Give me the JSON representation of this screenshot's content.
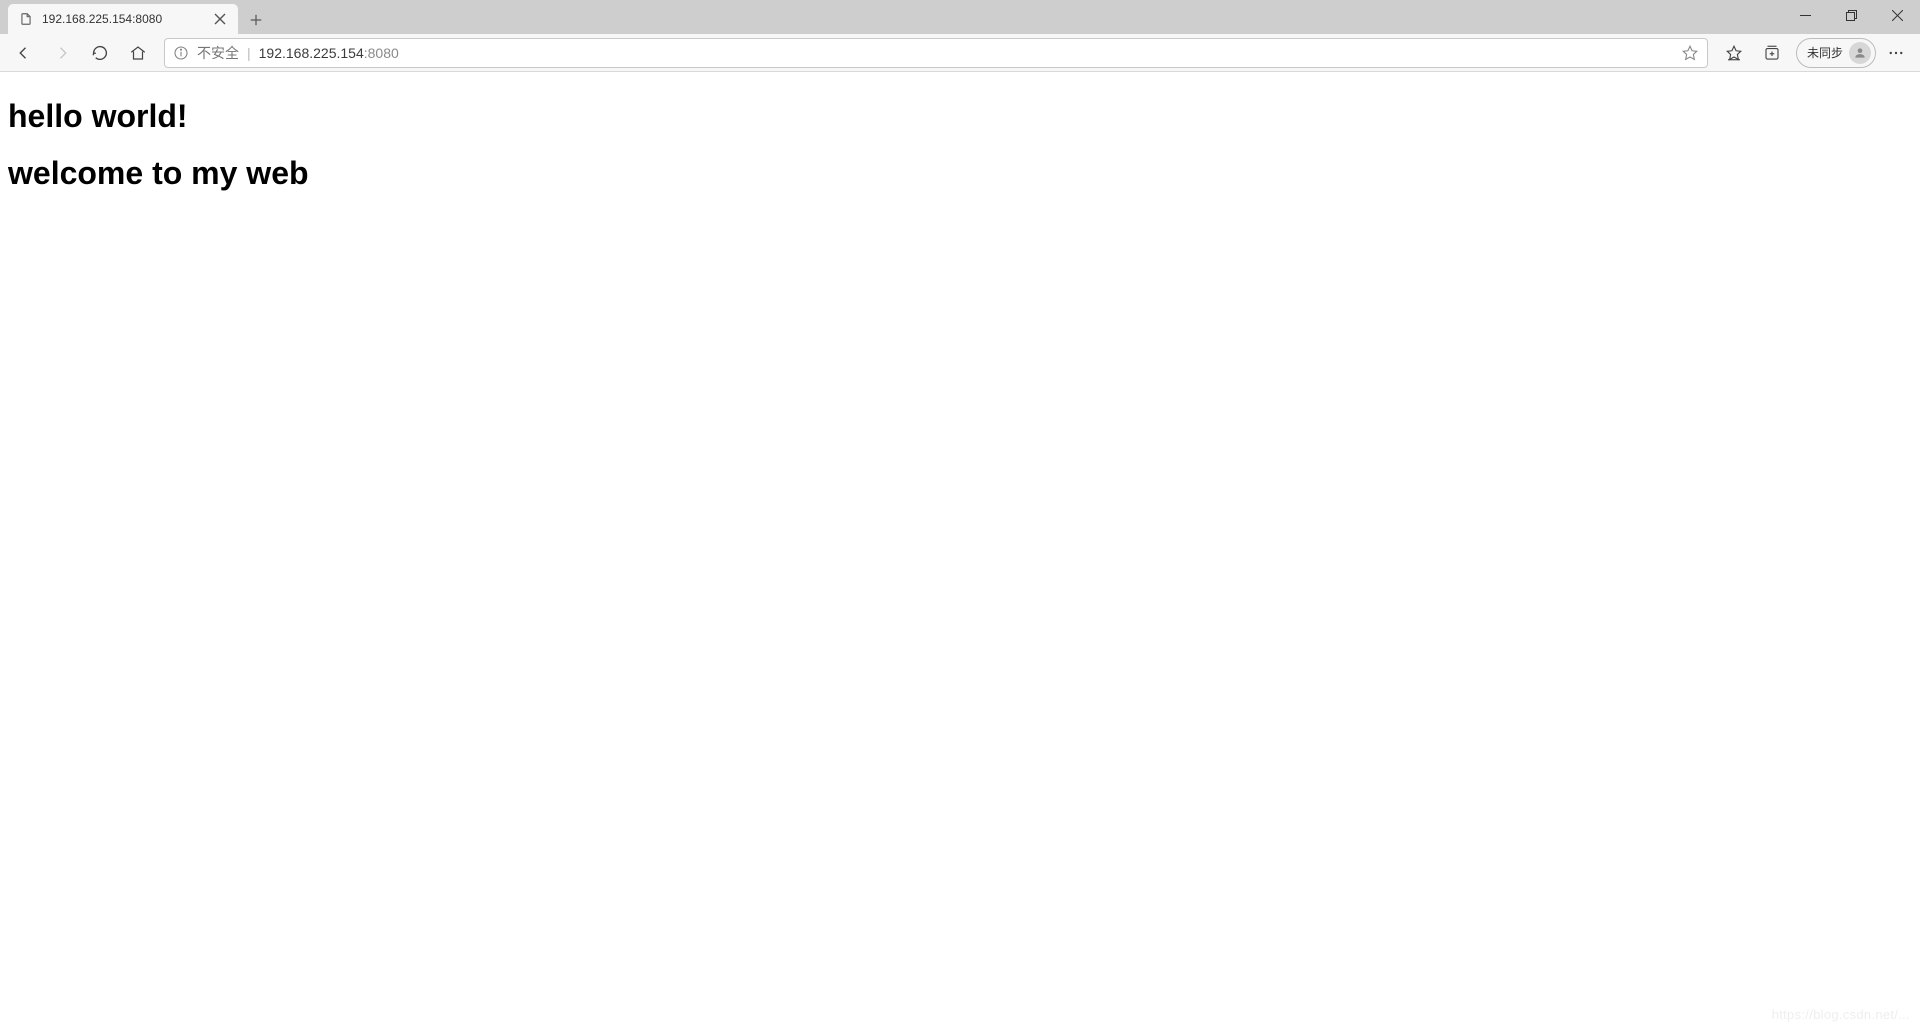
{
  "window": {
    "minimize_tooltip": "Minimize",
    "maximize_tooltip": "Restore",
    "close_tooltip": "Close"
  },
  "tab": {
    "title": "192.168.225.154:8080",
    "favicon": "page-icon"
  },
  "toolbar": {
    "back_tooltip": "Back",
    "forward_tooltip": "Forward",
    "refresh_tooltip": "Refresh",
    "home_tooltip": "Home"
  },
  "address": {
    "security_label": "不安全",
    "separator": "|",
    "url_host": "192.168.225.154",
    "url_port": ":8080"
  },
  "right_icons": {
    "favorite_tooltip": "Add to favorites",
    "favorites_list_tooltip": "Favorites",
    "collections_tooltip": "Collections",
    "more_tooltip": "Settings and more"
  },
  "profile": {
    "label": "未同步"
  },
  "page": {
    "heading1": "hello world!",
    "heading2": "welcome to my web"
  },
  "watermark": "https://blog.csdn.net/..."
}
